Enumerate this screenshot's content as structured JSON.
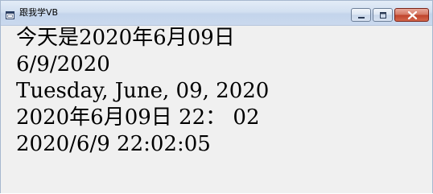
{
  "window": {
    "title": "跟我学VB",
    "icon": "app-window-icon",
    "controls": {
      "minimize_icon": "minimize-icon",
      "maximize_icon": "maximize-icon",
      "close_icon": "close-icon"
    }
  },
  "output": {
    "lines": [
      "今天是2020年6月09日",
      "6/9/2020",
      "Tuesday, June, 09, 2020",
      "2020年6月09日 22： 02",
      "2020/6/9 22:02:05"
    ]
  },
  "colors": {
    "title_bar": "#d3e0f1",
    "client_background": "#f0f0f0",
    "close_button": "#c0452d",
    "text": "#000000"
  }
}
